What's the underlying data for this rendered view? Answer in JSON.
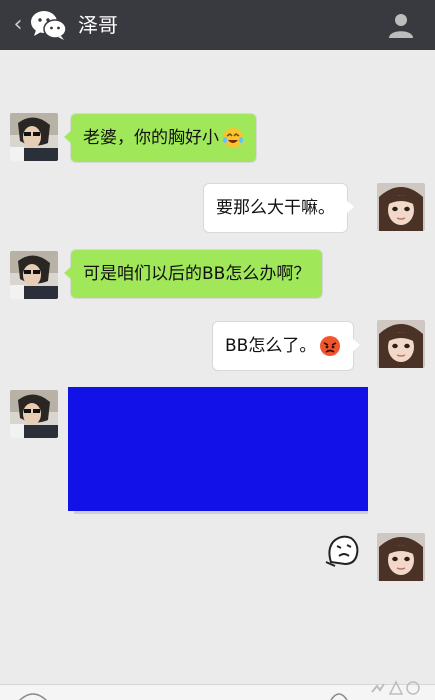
{
  "header": {
    "back_icon": "chevron-left-icon",
    "logo_icon": "wechat-icon",
    "title": "泽哥",
    "profile_icon": "person-icon"
  },
  "messages": [
    {
      "side": "left",
      "text": "老婆，你的胸好小",
      "emoji": "laughing-tears-emoji"
    },
    {
      "side": "right",
      "text": "要那么大干嘛。"
    },
    {
      "side": "left",
      "text": "可是咱们以后的BB怎么办啊？"
    },
    {
      "side": "right",
      "text": "BB怎么了。",
      "emoji": "angry-face-emoji"
    },
    {
      "side": "left",
      "type": "image",
      "content": "redacted"
    },
    {
      "side": "right",
      "type": "sticker",
      "sticker": "confused-sticker"
    }
  ],
  "colors": {
    "header_bg": "#393a3f",
    "chat_bg": "#ebebeb",
    "left_bubble": "#a0e75a",
    "right_bubble": "#ffffff",
    "redacted_fill": "#1212e8"
  }
}
